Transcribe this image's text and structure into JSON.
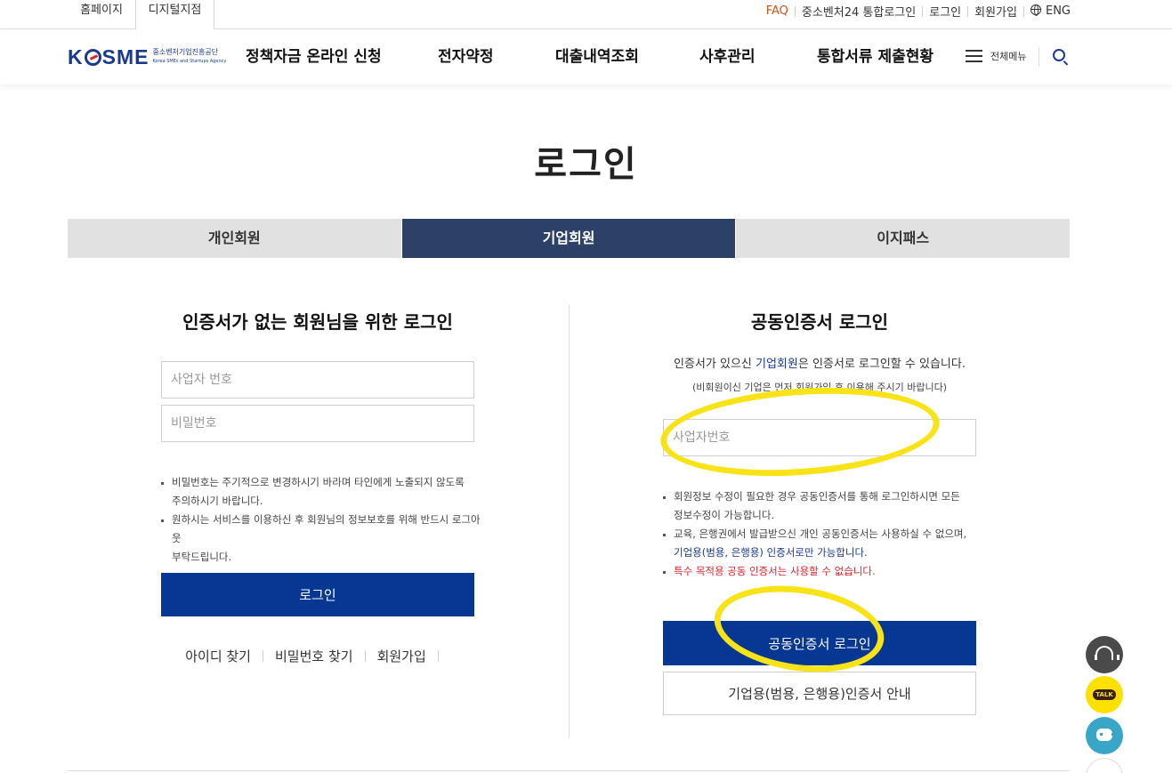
{
  "topbar": {
    "site_tabs": [
      "홈페이지",
      "디지털지점"
    ],
    "util_links": {
      "faq": "FAQ",
      "integrated_login": "중소벤처24 통합로그인",
      "login": "로그인",
      "signup": "회원가입",
      "eng": "ENG"
    }
  },
  "header": {
    "logo_text": "KOSME",
    "logo_sub_ko": "중소벤처기업진흥공단",
    "logo_sub_en": "Korea SMEs and Startups Agency",
    "nav": [
      "정책자금 온라인 신청",
      "전자약정",
      "대출내역조회",
      "사후관리",
      "통합서류 제출현황"
    ],
    "all_menu": "전체메뉴"
  },
  "page_title": "로그인",
  "member_tabs": [
    "개인회원",
    "기업회원",
    "이지패스"
  ],
  "left": {
    "title": "인증서가 없는 회원님을 위한 로그인",
    "business_no_placeholder": "사업자 번호",
    "password_placeholder": "비밀번호",
    "notes": [
      "비밀번호는 주기적으로 변경하시기 바라며 타인에게 노출되지 않도록",
      "주의하시기 바랍니다.",
      "원하시는 서비스를 이용하신 후 회원님의 정보보호를 위해 반드시 로그아웃",
      "부탁드립니다."
    ],
    "login_button": "로그인",
    "links": [
      "아이디 찾기",
      "비밀번호 찾기",
      "회원가입"
    ]
  },
  "right": {
    "title": "공동인증서 로그인",
    "info_pre": "인증서가 있으신 ",
    "info_link": "기업회원",
    "info_post": "은 인증서로 로그인할 수 있습니다.",
    "info_sub": "(비회원이신 기업은 먼저 회원가입 후 이용해 주시기 바랍니다)",
    "business_no_placeholder": "사업자번호",
    "notes": [
      "회원정보 수정이 필요한 경우 공동인증서를 통해 로그인하시면 모든",
      "정보수정이 가능합니다.",
      "교육, 은행권에서 발급받으신 개인 공동인증서는 사용하실 수 없으며,",
      "기업용(범용, 은행용) 인증서로만 가능합니다.",
      "특수 목적용 공동 인증서는 사용할 수 없습니다."
    ],
    "cert_login_button": "공동인증서 로그인",
    "cert_guide_button": "기업용(범용, 은행용)인증서 안내"
  },
  "floating": {
    "talk_label": "TALK"
  },
  "colors": {
    "primary_button": "#053793",
    "active_tab": "#2d4068",
    "warning_text": "#d6272e",
    "annotation": "#f7e318"
  }
}
